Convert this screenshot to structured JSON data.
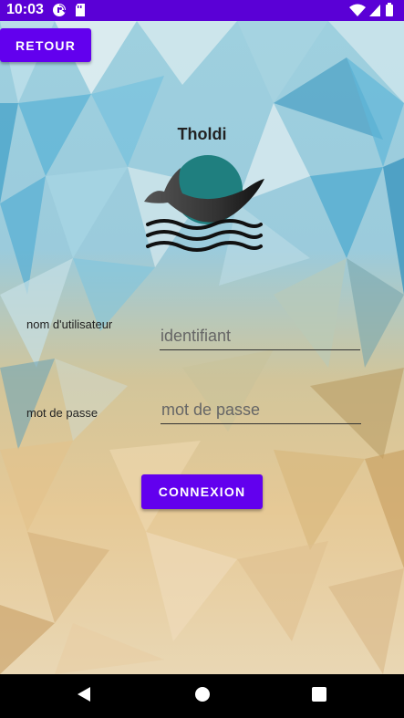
{
  "status_bar": {
    "time": "10:03",
    "background_color": "#5a00d6",
    "icons_left": [
      "sync-icon",
      "sd-card-icon"
    ],
    "icons_right": [
      "wifi-icon",
      "signal-icon",
      "battery-icon"
    ]
  },
  "header": {
    "back_label": "RETOUR",
    "app_title": "Tholdi"
  },
  "logo": {
    "icon": "whale-logo-icon",
    "primary_color": "#1f7f7f"
  },
  "form": {
    "username_label": "nom d'utilisateur",
    "username_placeholder": "identifiant",
    "username_value": "",
    "password_label": "mot de passe",
    "password_placeholder": "mot de passe",
    "password_value": "",
    "submit_label": "CONNEXION"
  },
  "colors": {
    "accent": "#6200ee"
  },
  "nav_bar": {
    "icons": [
      "back-triangle-icon",
      "home-circle-icon",
      "recents-square-icon"
    ]
  }
}
